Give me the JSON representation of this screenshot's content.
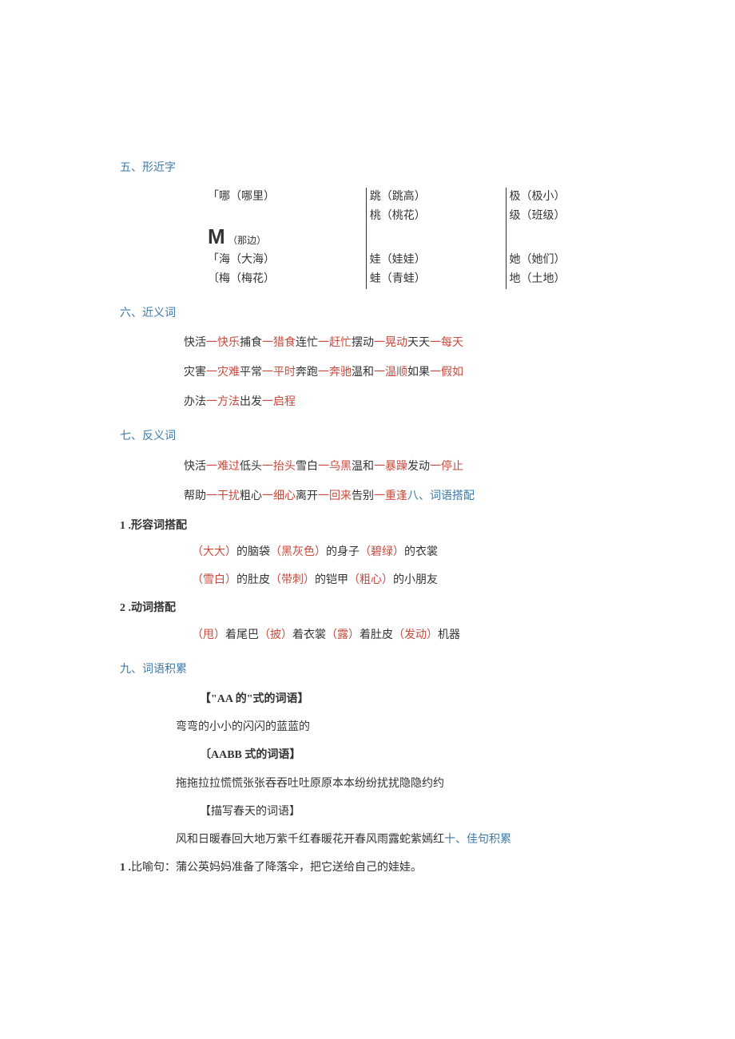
{
  "sec5": {
    "title": "五、形近字",
    "rows": [
      {
        "a": {
          "l1": "「哪（哪里）",
          "l2": ""
        },
        "b": {
          "l1": "跳（跳高）",
          "l2": "桃（桃花）"
        },
        "c": {
          "l1": "极（极小）",
          "l2": "级（班级）"
        }
      },
      {
        "a": {
          "m": "M",
          "m_sub": "（那边）"
        },
        "b": {
          "l1": "",
          "l2": ""
        },
        "c": {
          "l1": "",
          "l2": ""
        }
      },
      {
        "a": {
          "l1": "「海（大海）",
          "l2": "〔梅（梅花）"
        },
        "b": {
          "l1": "娃（娃娃）",
          "l2": "蛙（青蛙）"
        },
        "c": {
          "l1": "她（她们）",
          "l2": "地（土地）"
        }
      }
    ]
  },
  "sec6": {
    "title": "六、近义词",
    "lines": [
      [
        {
          "t": "快活",
          "c": "k"
        },
        {
          "t": "一快乐",
          "c": "r"
        },
        {
          "t": "捕食",
          "c": "k"
        },
        {
          "t": "一猎食",
          "c": "r"
        },
        {
          "t": "连忙",
          "c": "k"
        },
        {
          "t": "一赶忙",
          "c": "r"
        },
        {
          "t": "摆动",
          "c": "k"
        },
        {
          "t": "一晃动",
          "c": "r"
        },
        {
          "t": "天天",
          "c": "k"
        },
        {
          "t": "一每天",
          "c": "r"
        }
      ],
      [
        {
          "t": "灾害",
          "c": "k"
        },
        {
          "t": "一灾难",
          "c": "r"
        },
        {
          "t": "平常",
          "c": "k"
        },
        {
          "t": "一平时",
          "c": "r"
        },
        {
          "t": "奔跑",
          "c": "k"
        },
        {
          "t": "一奔驰",
          "c": "r"
        },
        {
          "t": "温和",
          "c": "k"
        },
        {
          "t": "一温顺",
          "c": "r"
        },
        {
          "t": "如果",
          "c": "k"
        },
        {
          "t": "一假如",
          "c": "r"
        }
      ],
      [
        {
          "t": "办法",
          "c": "k"
        },
        {
          "t": "一方法",
          "c": "r"
        },
        {
          "t": "出发",
          "c": "k"
        },
        {
          "t": "一启程",
          "c": "r"
        }
      ]
    ]
  },
  "sec7": {
    "title": "七、反义词",
    "lines": [
      [
        {
          "t": "快活",
          "c": "k"
        },
        {
          "t": "一难过",
          "c": "r"
        },
        {
          "t": "低头",
          "c": "k"
        },
        {
          "t": "一抬头",
          "c": "r"
        },
        {
          "t": "雪白",
          "c": "k"
        },
        {
          "t": "一乌黑",
          "c": "r"
        },
        {
          "t": "温和",
          "c": "k"
        },
        {
          "t": "一暴躁",
          "c": "r"
        },
        {
          "t": "发动",
          "c": "k"
        },
        {
          "t": "一停止",
          "c": "r"
        }
      ],
      [
        {
          "t": "帮助",
          "c": "k"
        },
        {
          "t": "一干扰",
          "c": "r"
        },
        {
          "t": "粗心",
          "c": "k"
        },
        {
          "t": "一细心",
          "c": "r"
        },
        {
          "t": "离开",
          "c": "k"
        },
        {
          "t": "一回来",
          "c": "r"
        },
        {
          "t": "告别",
          "c": "k"
        },
        {
          "t": "一重逢",
          "c": "r"
        },
        {
          "t": "八、词语搭配",
          "c": "b"
        }
      ]
    ]
  },
  "sec8": {
    "item1_num": "1 .形容词搭配",
    "item1_lines": [
      [
        {
          "t": "（大大）",
          "c": "r"
        },
        {
          "t": "的脑袋",
          "c": "k"
        },
        {
          "t": "（黑灰色）",
          "c": "r"
        },
        {
          "t": "的身子",
          "c": "k"
        },
        {
          "t": "（碧绿）",
          "c": "r"
        },
        {
          "t": "的衣裳",
          "c": "k"
        }
      ],
      [
        {
          "t": "（雪白）",
          "c": "r"
        },
        {
          "t": "的肚皮",
          "c": "k"
        },
        {
          "t": "（带刺）",
          "c": "r"
        },
        {
          "t": "的铠甲",
          "c": "k"
        },
        {
          "t": "（粗心）",
          "c": "r"
        },
        {
          "t": "的小朋友",
          "c": "k"
        }
      ]
    ],
    "item2_num": "2 .动词搭配",
    "item2_lines": [
      [
        {
          "t": "（甩）",
          "c": "r"
        },
        {
          "t": "着尾巴",
          "c": "k"
        },
        {
          "t": "（披）",
          "c": "r"
        },
        {
          "t": "着衣裳",
          "c": "k"
        },
        {
          "t": "（露）",
          "c": "r"
        },
        {
          "t": "着肚皮",
          "c": "k"
        },
        {
          "t": "（发动）",
          "c": "r"
        },
        {
          "t": "机器",
          "c": "k"
        }
      ]
    ]
  },
  "sec9": {
    "title": "九、词语积累",
    "groups": [
      {
        "label": "【\"AA 的\"式的词语】",
        "bold": true,
        "line": "弯弯的小小的闪闪的蓝蓝的"
      },
      {
        "label": "〔AABB 式的词语】",
        "bold": true,
        "line": "拖拖拉拉慌慌张张吞吞吐吐原原本本纷纷扰扰隐隐约约"
      },
      {
        "label": "【描写春天的词语】",
        "bold": false,
        "line_mixed": [
          {
            "t": "风和日暖春回大地万紫千红春暖花开春风雨露蛇紫嫣红",
            "c": "k"
          },
          {
            "t": "十、佳句积累",
            "c": "b"
          }
        ]
      }
    ]
  },
  "sec10": {
    "item1": "1 .比喻句：蒲公英妈妈准备了降落伞，把它送给自己的娃娃。"
  }
}
